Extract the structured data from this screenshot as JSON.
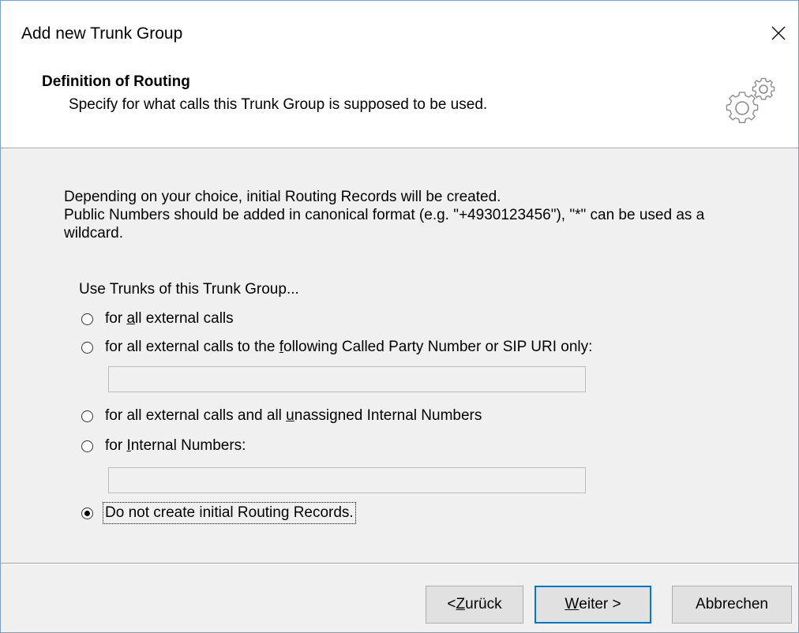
{
  "window": {
    "title": "Add new Trunk Group"
  },
  "header": {
    "title": "Definition of Routing",
    "subtitle": "Specify for what calls this Trunk Group is supposed to be used."
  },
  "description": {
    "line1": "Depending on your choice, initial Routing Records will be created.",
    "line2": "Public Numbers should be added in canonical format (e.g. \"+4930123456\"), \"*\" can be used as a wildcard."
  },
  "options": {
    "group_label": "Use Trunks of this Trunk Group...",
    "all_external": {
      "pre": "for ",
      "key": "a",
      "post": "ll external calls",
      "checked": false
    },
    "following_number": {
      "pre": "for all external calls to the ",
      "key": "f",
      "post": "ollowing Called Party Number or SIP URI only:",
      "checked": false,
      "value": ""
    },
    "unassigned": {
      "pre": "for all external calls and all ",
      "key": "u",
      "post": "nassigned Internal Numbers",
      "checked": false
    },
    "internal_numbers": {
      "pre": "for ",
      "key": "I",
      "post": "nternal Numbers:",
      "checked": false,
      "value": ""
    },
    "no_records": {
      "label": "Do not create initial Routing Records.",
      "checked": true
    }
  },
  "buttons": {
    "back": {
      "pre": "< ",
      "key": "Z",
      "post": "urück"
    },
    "next": {
      "pre": "",
      "key": "W",
      "post": "eiter >"
    },
    "cancel": {
      "label": "Abbrechen"
    }
  },
  "icons": {
    "close": "close-icon",
    "gear": "gears-icon"
  },
  "colors": {
    "accent": "#0078d7",
    "window_border": "#7a9fd0",
    "dialog_bg": "#f0f0f0"
  }
}
